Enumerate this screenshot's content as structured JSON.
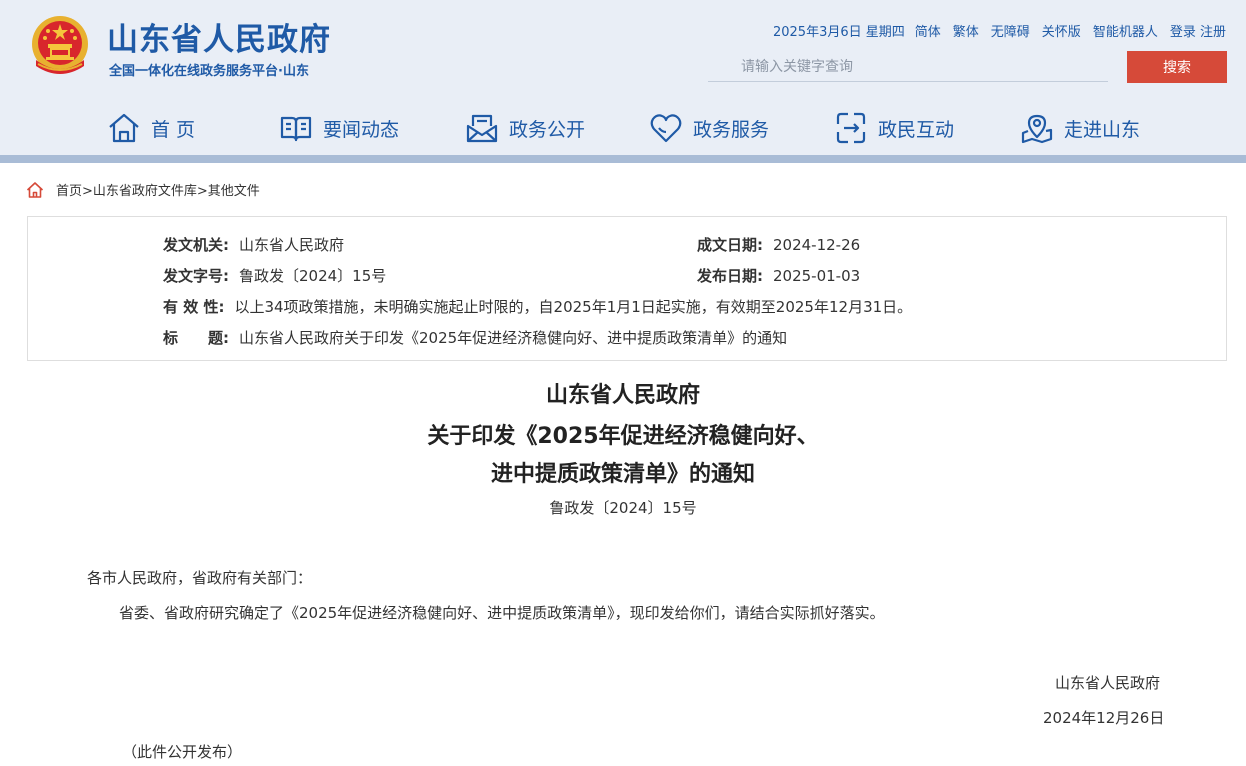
{
  "header": {
    "site_title": "山东省人民政府",
    "site_subtitle": "全国一体化在线政务服务平台·山东",
    "top_links": {
      "date": "2025年3月6日 星期四",
      "simplified": "简体",
      "traditional": "繁体",
      "accessible": "无障碍",
      "care": "关怀版",
      "robot": "智能机器人",
      "login": "登录",
      "register": "注册"
    },
    "search": {
      "placeholder": "请输入关键字查询",
      "button": "搜索"
    },
    "nav": [
      {
        "label": "首 页",
        "icon": "house-icon"
      },
      {
        "label": "要闻动态",
        "icon": "book-icon"
      },
      {
        "label": "政务公开",
        "icon": "inbox-icon"
      },
      {
        "label": "政务服务",
        "icon": "heart-icon"
      },
      {
        "label": "政民互动",
        "icon": "exchange-icon"
      },
      {
        "label": "走进山东",
        "icon": "map-pin-icon"
      }
    ]
  },
  "breadcrumb": "首页>山东省政府文件库>其他文件",
  "info": {
    "issuer_label": "发文机关:",
    "issuer": "山东省人民政府",
    "created_label": "成文日期:",
    "created": "2024-12-26",
    "docno_label": "发文字号:",
    "docno": "鲁政发〔2024〕15号",
    "published_label": "发布日期:",
    "published": "2025-01-03",
    "validity_label": "有 效 性:",
    "validity": "以上34项政策措施，未明确实施起止时限的，自2025年1月1日起实施，有效期至2025年12月31日。",
    "title_label": "标　　题:",
    "title": "山东省人民政府关于印发《2025年促进经济稳健向好、进中提质政策清单》的通知"
  },
  "article": {
    "title_line1": "山东省人民政府",
    "title_line2": "关于印发《2025年促进经济稳健向好、",
    "title_line3": "进中提质政策清单》的通知",
    "doc_no": "鲁政发〔2024〕15号",
    "salutation": "各市人民政府，省政府有关部门：",
    "body": "省委、省政府研究确定了《2025年促进经济稳健向好、进中提质政策清单》，现印发给你们，请结合实际抓好落实。",
    "signature": "山东省人民政府",
    "date": "2024年12月26日",
    "note": "（此件公开发布）"
  },
  "colors": {
    "brand_blue": "#1f5aa6",
    "search_red": "#d64a39",
    "header_bg": "#e9eef6"
  }
}
